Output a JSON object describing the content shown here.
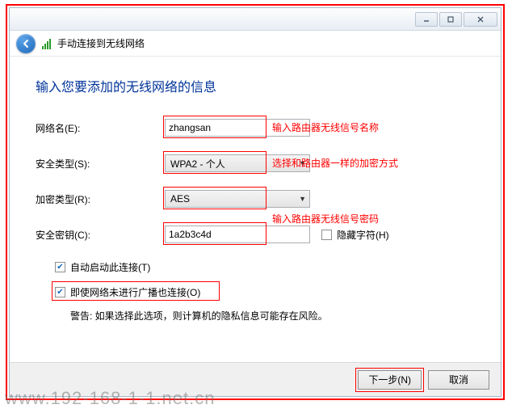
{
  "window": {
    "header_title": "手动连接到无线网络"
  },
  "heading": "输入您要添加的无线网络的信息",
  "form": {
    "network_name_label": "网络名(E):",
    "network_name_value": "zhangsan",
    "security_type_label": "安全类型(S):",
    "security_type_value": "WPA2 - 个人",
    "encryption_type_label": "加密类型(R):",
    "encryption_type_value": "AES",
    "security_key_label": "安全密钥(C):",
    "security_key_value": "1a2b3c4d",
    "hide_chars_label": "隐藏字符(H)"
  },
  "annotations": {
    "network_name": "输入路由器无线信号名称",
    "security_type": "选择和路由器一样的加密方式",
    "security_key": "输入路由器无线信号密码"
  },
  "checkboxes": {
    "auto_start_label": "自动启动此连接(T)",
    "connect_even_hidden_label": "即使网络未进行广播也连接(O)",
    "warning": "警告: 如果选择此选项，则计算机的隐私信息可能存在风险。"
  },
  "buttons": {
    "next": "下一步(N)",
    "cancel": "取消"
  },
  "watermark": "www.192-168-1-1.net.cn"
}
